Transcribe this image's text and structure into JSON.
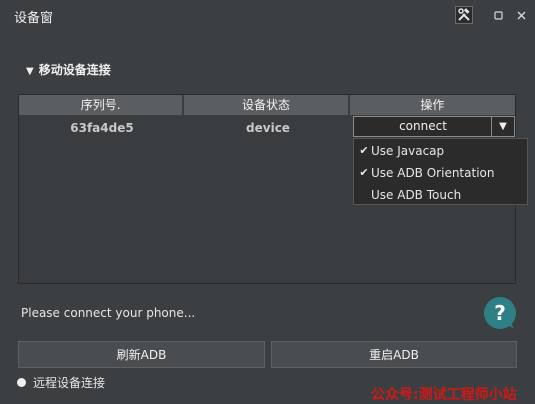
{
  "window": {
    "title": "设备窗",
    "tools_icon": "tools-icon",
    "restore_icon": "restore-icon",
    "close_icon": "close-icon"
  },
  "section": {
    "arrow_icon": "caret-down-icon",
    "label": "移动设备连接"
  },
  "table": {
    "columns": [
      "序列号.",
      "设备状态",
      "操作"
    ],
    "rows": [
      {
        "serial": "63fa4de5",
        "state": "device",
        "action": "connect"
      }
    ]
  },
  "dropdown": {
    "items": [
      {
        "label": "Use Javacap",
        "checked": true
      },
      {
        "label": "Use ADB Orientation",
        "checked": true
      },
      {
        "label": "Use ADB Touch",
        "checked": false
      }
    ]
  },
  "status_text": "Please connect your phone...",
  "help": {
    "label": "?"
  },
  "buttons": {
    "refresh": "刷新ADB",
    "restart": "重启ADB"
  },
  "remote": {
    "label": "远程设备连接"
  },
  "watermark": "公众号:测试工程师小站"
}
